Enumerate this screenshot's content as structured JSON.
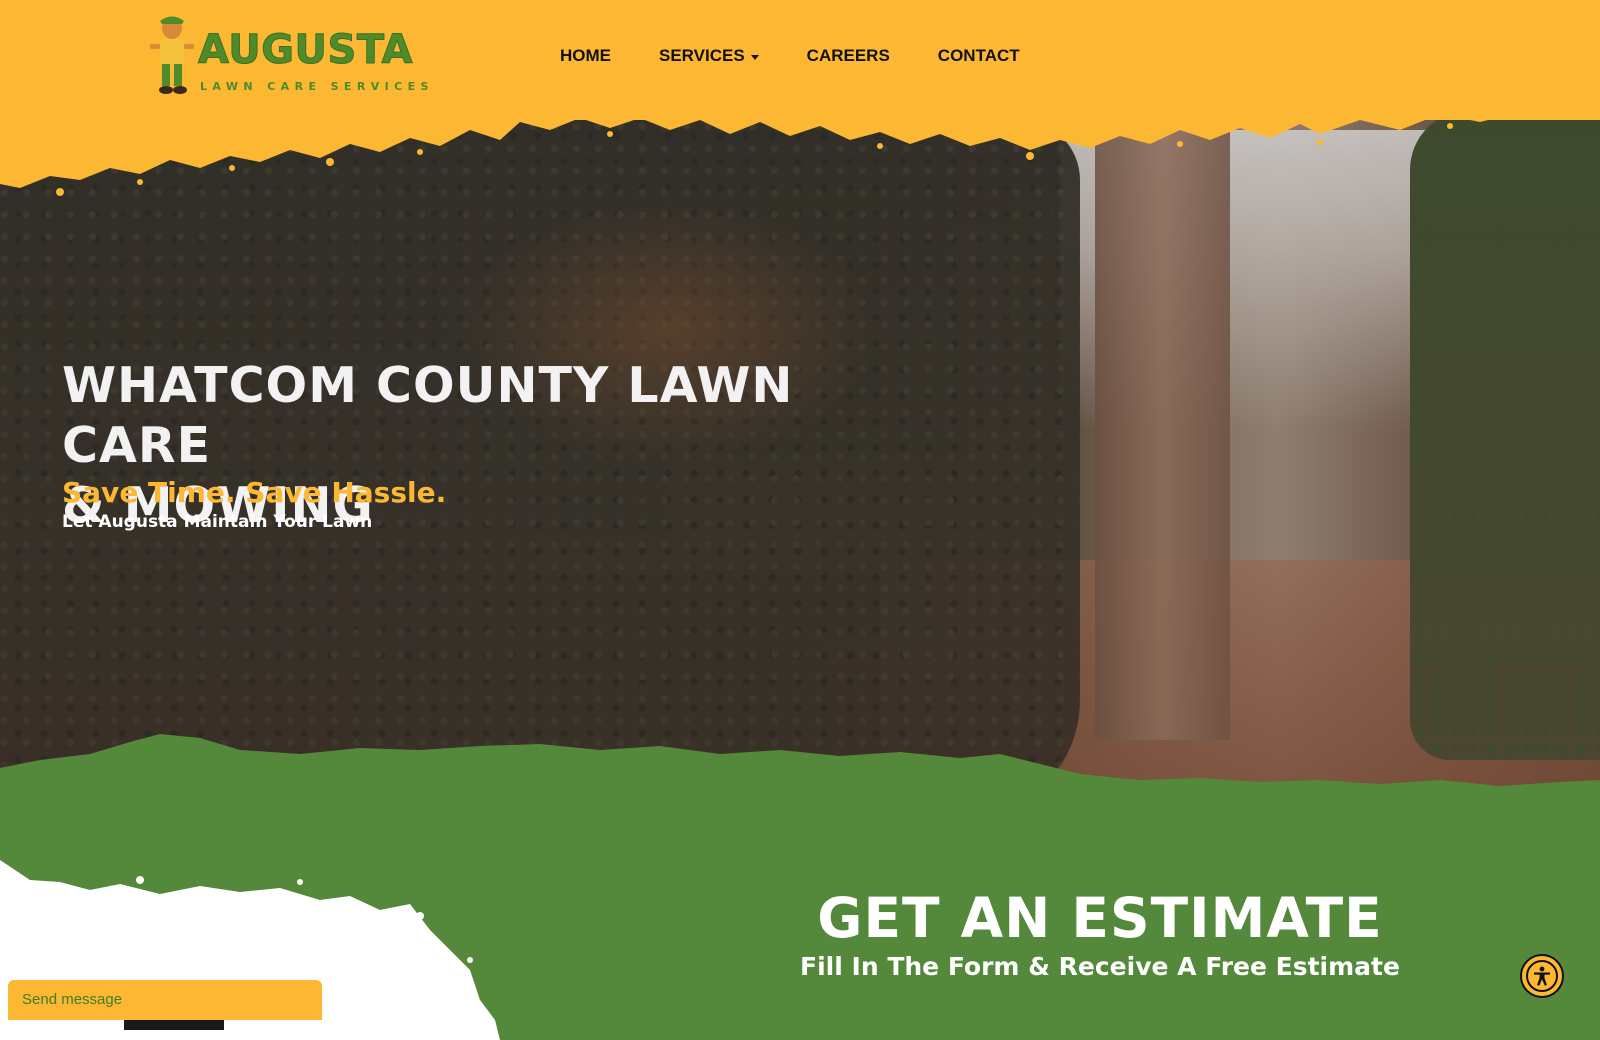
{
  "brand": {
    "name": "AUGUSTA",
    "tagline": "LAWN CARE SERVICES"
  },
  "nav": {
    "items": [
      {
        "label": "HOME",
        "has_dropdown": false
      },
      {
        "label": "SERVICES",
        "has_dropdown": true
      },
      {
        "label": "CAREERS",
        "has_dropdown": false
      },
      {
        "label": "CONTACT",
        "has_dropdown": false
      }
    ]
  },
  "hero": {
    "title_line1": "WHATCOM COUNTY LAWN CARE",
    "title_line2": "& MOWING",
    "subtitle": "Save Time. Save Hassle.",
    "subtitle2": "Let Augusta Maintain Your Lawn"
  },
  "estimate": {
    "title": "GET AN ESTIMATE",
    "subtitle": "Fill In The Form & Receive A Free Estimate"
  },
  "chat": {
    "label": "Send message"
  },
  "accessibility": {
    "icon": "accessibility-icon"
  },
  "colors": {
    "brand_yellow": "#fcb832",
    "brand_green": "#54883a",
    "logo_green": "#4f8a2b"
  }
}
